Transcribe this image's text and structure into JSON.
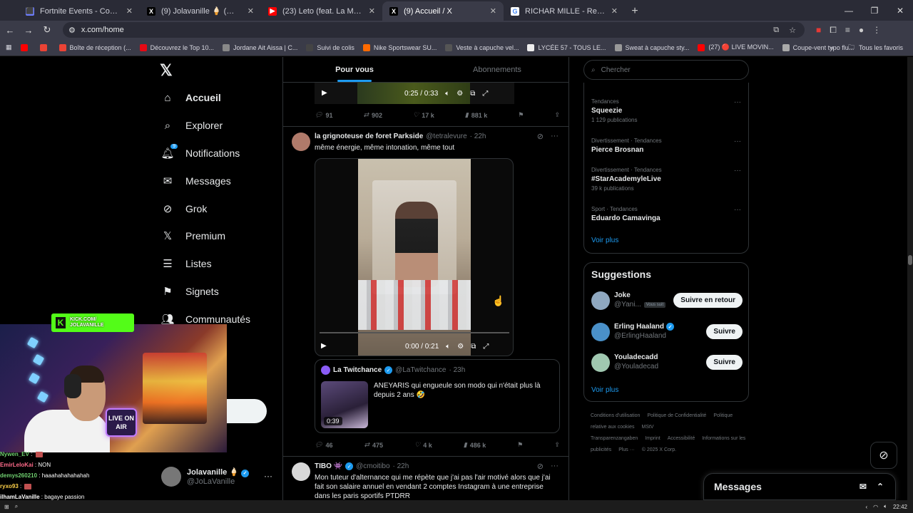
{
  "browser": {
    "tabs": [
      {
        "title": "Fortnite Events - Competitive To",
        "color": "#6b7cff",
        "glyph": "⬛",
        "active": false
      },
      {
        "title": "(9) Jolavanille 🍦 (@JoLaVanille)",
        "color": "#000000",
        "glyph": "X",
        "active": false
      },
      {
        "title": "(23) Leto (feat. La Mano 1.9) - 2",
        "color": "#ff0000",
        "glyph": "▶",
        "active": false
      },
      {
        "title": "(9) Accueil / X",
        "color": "#000000",
        "glyph": "X",
        "active": true
      },
      {
        "title": "RICHAR MILLE - Recherche Goo",
        "color": "#ffffff",
        "glyph": "G",
        "active": false
      }
    ],
    "url": "x.com/home",
    "bookmarks": [
      {
        "label": "",
        "color": "#ff0000"
      },
      {
        "label": "",
        "color": "#ea4335"
      },
      {
        "label": "Boîte de réception (...",
        "color": "#ea4335"
      },
      {
        "label": "Découvrez le Top 10...",
        "color": "#e50914"
      },
      {
        "label": "Jordane Ait Aissa | C...",
        "color": "#888888"
      },
      {
        "label": "Suivi de colis",
        "color": "#444444"
      },
      {
        "label": "Nike Sportswear SU...",
        "color": "#ff6a00"
      },
      {
        "label": "Veste à capuche vel...",
        "color": "#555555"
      },
      {
        "label": "LYCÉE 57 - TOUS LE...",
        "color": "#eeeeee"
      },
      {
        "label": "Sweat à capuche sty...",
        "color": "#999999"
      },
      {
        "label": "(27) 🔴 LIVE MOVIN...",
        "color": "#ff0000"
      },
      {
        "label": "Coupe-vent typo flu...",
        "color": "#aaaaaa"
      }
    ],
    "all_bookmarks_label": "Tous les favoris"
  },
  "nav": {
    "logo": "𝕏",
    "items": [
      {
        "label": "Accueil",
        "icon": "⌂",
        "active": true
      },
      {
        "label": "Explorer",
        "icon": "⌕"
      },
      {
        "label": "Notifications",
        "icon": "🔔︎",
        "badge": "9"
      },
      {
        "label": "Messages",
        "icon": "✉"
      },
      {
        "label": "Grok",
        "icon": "⊘"
      },
      {
        "label": "Premium",
        "icon": "𝕏"
      },
      {
        "label": "Listes",
        "icon": "☰"
      },
      {
        "label": "Signets",
        "icon": "⚑"
      },
      {
        "label": "Communautés",
        "icon": "👥︎"
      }
    ],
    "account": {
      "name": "Jolavanille 🍦",
      "handle": "@JoLaVanille",
      "more": "···"
    }
  },
  "main": {
    "tabs": [
      {
        "label": "Pour vous",
        "active": true
      },
      {
        "label": "Abonnements",
        "active": false
      }
    ],
    "top_video": {
      "time": "0:25 / 0:33"
    },
    "top_actions": {
      "replies": "91",
      "reposts": "902",
      "likes": "17 k",
      "views": "881 k"
    },
    "tweet1": {
      "name": "la grignoteuse de foret Parkside",
      "handle": "@tetralevure",
      "time": "· 22h",
      "text": "même énergie, même intonation, même tout",
      "video_time": "0:00 / 0:21",
      "video_progress": 0,
      "quote": {
        "name": "La Twitchance",
        "handle": "@LaTwitchance",
        "time": "· 23h",
        "text": "ANEYARIS qui engueule son modo qui n'était plus là depuis 2 ans 🤣",
        "duration": "0:39"
      },
      "actions": {
        "replies": "46",
        "reposts": "475",
        "likes": "4 k",
        "views": "486 k"
      }
    },
    "tweet2": {
      "name": "TIBO 👾",
      "handle": "@cmoitibo",
      "time": "· 22h",
      "text": "Mon tuteur d'alternance qui me répète que j'ai pas l'air motivé alors que j'ai fait son salaire annuel en vendant 2 comptes Instagram à une entreprise dans les paris sportifs PTDRR"
    }
  },
  "right": {
    "search_placeholder": "Chercher",
    "trends": [
      {
        "context": "Tendances",
        "title": "Squeezie",
        "count": "1 129 publications"
      },
      {
        "context": "Divertissement · Tendances",
        "title": "Pierce Brosnan",
        "count": ""
      },
      {
        "context": "Divertissement · Tendances",
        "title": "#StarAcademyleLive",
        "count": "39 k publications"
      },
      {
        "context": "Sport · Tendances",
        "title": "Eduardo Camavinga",
        "count": ""
      }
    ],
    "trends_more": "Voir plus",
    "suggestions_title": "Suggestions",
    "suggestions": [
      {
        "name": "Joke",
        "handle": "@Yani...",
        "badge": "Vous suit",
        "button": "Suivre en retour",
        "verified": false,
        "color": "#8fa8c0"
      },
      {
        "name": "Erling Haaland",
        "handle": "@ErlingHaaland",
        "badge": "",
        "button": "Suivre",
        "verified": true,
        "color": "#4a90c8"
      },
      {
        "name": "Youladecadd",
        "handle": "@Youladecad",
        "badge": "",
        "button": "Suivre",
        "verified": false,
        "color": "#a0c8b0"
      }
    ],
    "suggestions_more": "Voir plus",
    "footer": [
      "Conditions d'utilisation",
      "Politique de Confidentialité",
      "Politique relative aux cookies",
      "MStV Transparenzangaben",
      "Imprint",
      "Accessibilité",
      "Informations sur les publicités",
      "Plus ···",
      "© 2025 X Corp."
    ],
    "messages_label": "Messages"
  },
  "stream": {
    "kick_line1": "KICK.COM/",
    "kick_line2": "JOLAVANILLE",
    "sign_text": "LIVE ON AIR",
    "chat": [
      {
        "user": "Nywen_EV",
        "color": "#6fcf6f",
        "msg": "",
        "emote": true
      },
      {
        "user": "EmirLeloKai",
        "color": "#ff6b8a",
        "msg": "NON",
        "emote": false
      },
      {
        "user": "demys260210",
        "color": "#6fcf6f",
        "msg": "haaahahahahahah",
        "emote": false
      },
      {
        "user": "ryxo93",
        "color": "#ffd24a",
        "msg": "",
        "emote": true
      },
      {
        "user": "ilhamLaVanille",
        "color": "#ffffff",
        "msg": "bagaye passion",
        "emote": false
      }
    ]
  },
  "taskbar": {
    "clock": "22:42"
  }
}
